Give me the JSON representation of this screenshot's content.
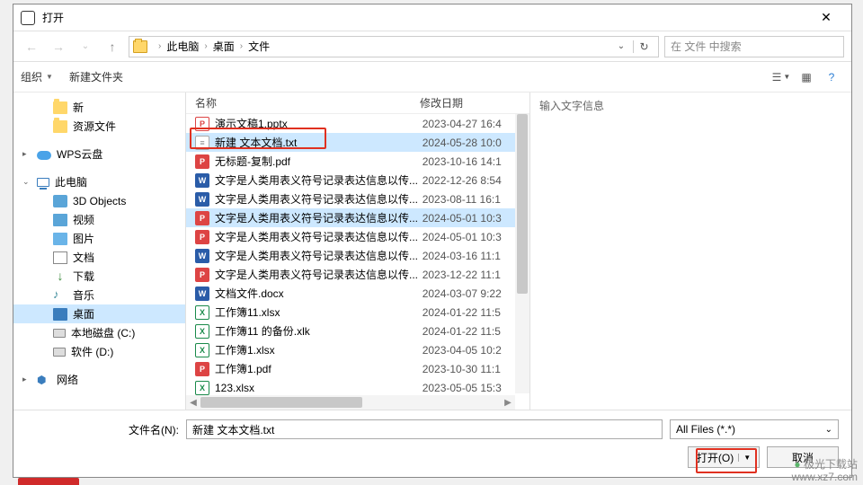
{
  "titlebar": {
    "title": "打开"
  },
  "breadcrumb": {
    "items": [
      "此电脑",
      "桌面",
      "文件"
    ],
    "dropdown_symbol": "⌄",
    "refresh_symbol": "↻"
  },
  "nav": {
    "back": "←",
    "forward": "→",
    "up": "↑"
  },
  "search": {
    "placeholder": "在 文件 中搜索"
  },
  "toolbar": {
    "organize": "组织",
    "new_folder": "新建文件夹"
  },
  "columns": {
    "name": "名称",
    "modified": "修改日期"
  },
  "files": [
    {
      "name": "演示文稿1.pptx",
      "date": "2023-04-27 16:4",
      "icon": "pptx"
    },
    {
      "name": "新建 文本文档.txt",
      "date": "2024-05-28 10:0",
      "icon": "txt",
      "selected": true,
      "highlighted": true
    },
    {
      "name": "无标题-复制.pdf",
      "date": "2023-10-16 14:1",
      "icon": "pdf"
    },
    {
      "name": "文字是人类用表义符号记录表达信息以传...",
      "date": "2022-12-26 8:54",
      "icon": "docx"
    },
    {
      "name": "文字是人类用表义符号记录表达信息以传...",
      "date": "2023-08-11 16:1",
      "icon": "docx"
    },
    {
      "name": "文字是人类用表义符号记录表达信息以传...",
      "date": "2024-05-01 10:3",
      "icon": "pdf",
      "selected": true
    },
    {
      "name": "文字是人类用表义符号记录表达信息以传...",
      "date": "2024-05-01 10:3",
      "icon": "pdf"
    },
    {
      "name": "文字是人类用表义符号记录表达信息以传...",
      "date": "2024-03-16 11:1",
      "icon": "docx"
    },
    {
      "name": "文字是人类用表义符号记录表达信息以传...",
      "date": "2023-12-22 11:1",
      "icon": "pdf"
    },
    {
      "name": "文档文件.docx",
      "date": "2024-03-07 9:22",
      "icon": "docx"
    },
    {
      "name": "工作簿11.xlsx",
      "date": "2024-01-22 11:5",
      "icon": "xlsx"
    },
    {
      "name": "工作簿11 的备份.xlk",
      "date": "2024-01-22 11:5",
      "icon": "xlk"
    },
    {
      "name": "工作簿1.xlsx",
      "date": "2023-04-05 10:2",
      "icon": "xlsx"
    },
    {
      "name": "工作簿1.pdf",
      "date": "2023-10-30 11:1",
      "icon": "pdf"
    },
    {
      "name": "123.xlsx",
      "date": "2023-05-05 15:3",
      "icon": "xlsx"
    }
  ],
  "sidebar": {
    "quick": [
      {
        "label": "新",
        "icon": "folder"
      },
      {
        "label": "资源文件",
        "icon": "folder"
      }
    ],
    "cloud": {
      "label": "WPS云盘",
      "icon": "cloud"
    },
    "thispc": {
      "label": "此电脑",
      "icon": "pc"
    },
    "pc_children": [
      {
        "label": "3D Objects",
        "icon": "3d"
      },
      {
        "label": "视频",
        "icon": "video"
      },
      {
        "label": "图片",
        "icon": "pic"
      },
      {
        "label": "文档",
        "icon": "doc"
      },
      {
        "label": "下载",
        "icon": "down"
      },
      {
        "label": "音乐",
        "icon": "music"
      },
      {
        "label": "桌面",
        "icon": "desk",
        "selected": true
      },
      {
        "label": "本地磁盘 (C:)",
        "icon": "drive"
      },
      {
        "label": "软件 (D:)",
        "icon": "drive"
      }
    ],
    "network": {
      "label": "网络",
      "icon": "net"
    }
  },
  "preview": {
    "hint": "输入文字信息"
  },
  "footer": {
    "filename_label": "文件名(N):",
    "filename_value": "新建 文本文档.txt",
    "filter": "All Files (*.*)",
    "open": "打开(O)",
    "cancel": "取消"
  },
  "watermark": {
    "line1": "极光下载站",
    "line2": "www.xz7.com"
  }
}
